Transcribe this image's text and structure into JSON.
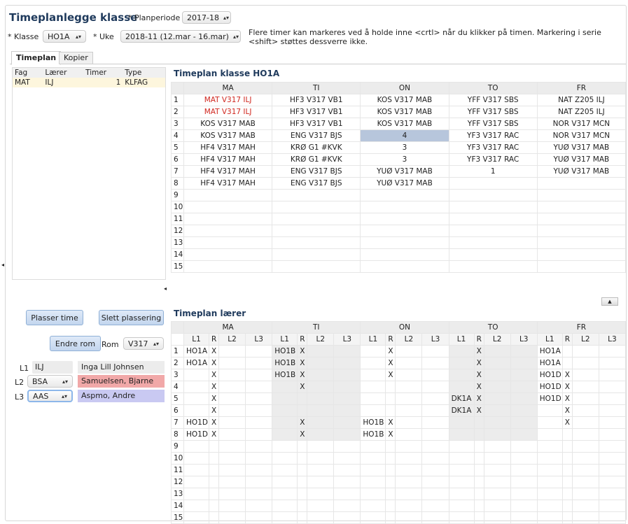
{
  "header": {
    "title": "Timeplanlegge klasse",
    "planperiode_label": "* Planperiode",
    "planperiode_value": "2017-18",
    "klasse_label": "* Klasse",
    "klasse_value": "HO1A",
    "uke_label": "* Uke",
    "uke_value": "2018-11 (12.mar - 16.mar)",
    "hint": "Flere timer kan markeres ved å holde inne <crtl> når du klikker på timen. Markering i serie <shift> støttes dessverre ikke."
  },
  "tabs": [
    {
      "label": "Timeplan"
    },
    {
      "label": "Kopier"
    }
  ],
  "subjects": {
    "headers": [
      "Fag",
      "Lærer",
      "Timer",
      "Type"
    ],
    "rows": [
      {
        "fag": "MAT",
        "laerer": "ILJ",
        "timer": "1",
        "type": "KLFAG"
      }
    ]
  },
  "class_schedule": {
    "title": "Timeplan klasse HO1A",
    "days": [
      "MA",
      "TI",
      "ON",
      "TO",
      "FR"
    ],
    "row_numbers": [
      "1",
      "2",
      "3",
      "4",
      "5",
      "6",
      "7",
      "8",
      "9",
      "10",
      "11",
      "12",
      "13",
      "14",
      "15"
    ],
    "rows": [
      [
        "MAT V317 ILJ",
        "HF3 V317 VB1",
        "KOS V317 MAB",
        "YFF V317 SBS",
        "NAT Z205 ILJ"
      ],
      [
        "MAT V317 ILJ",
        "HF3 V317 VB1",
        "KOS V317 MAB",
        "YFF V317 SBS",
        "NAT Z205 ILJ"
      ],
      [
        "KOS V317 MAB",
        "HF3 V317 VB1",
        "KOS V317 MAB",
        "YFF V317 SBS",
        "NOR V317 MCN"
      ],
      [
        "KOS V317 MAB",
        "ENG V317 BJS",
        "4",
        "YF3 V317 RAC",
        "NOR V317 MCN"
      ],
      [
        "HF4 V317 MAH",
        "KRØ G1 #KVK",
        "3",
        "YF3 V317 RAC",
        "YUØ V317 MAB"
      ],
      [
        "HF4 V317 MAH",
        "KRØ G1 #KVK",
        "3",
        "YF3 V317 RAC",
        "YUØ V317 MAB"
      ],
      [
        "HF4 V317 MAH",
        "ENG V317 BJS",
        "YUØ V317 MAB",
        "1",
        "YUØ V317 MAB"
      ],
      [
        "HF4 V317 MAH",
        "ENG V317 BJS",
        "YUØ V317 MAB",
        "",
        ""
      ],
      [
        "",
        "",
        "",
        "",
        ""
      ],
      [
        "",
        "",
        "",
        "",
        ""
      ],
      [
        "",
        "",
        "",
        "",
        ""
      ],
      [
        "",
        "",
        "",
        "",
        ""
      ],
      [
        "",
        "",
        "",
        "",
        ""
      ],
      [
        "",
        "",
        "",
        "",
        ""
      ],
      [
        "",
        "",
        "",
        "",
        ""
      ]
    ],
    "highlight_color": "#b7c6dc",
    "red_color": "#d0261e"
  },
  "buttons": {
    "plasser": "Plasser time",
    "slett": "Slett plassering",
    "endre_rom": "Endre rom"
  },
  "rom": {
    "label": "Rom",
    "value": "V317"
  },
  "teachers": [
    {
      "slot": "L1",
      "code": "ILJ",
      "name": "Inga Lill Johnsen",
      "color": "#ececec"
    },
    {
      "slot": "L2",
      "code": "BSA",
      "name": "Samuelsen, Bjarne",
      "color": "#f1a8a8"
    },
    {
      "slot": "L3",
      "code": "AAS",
      "name": "Aspmo, Andre",
      "color": "#c9c9f2"
    }
  ],
  "teacher_schedule": {
    "title": "Timeplan lærer",
    "days": [
      "MA",
      "TI",
      "ON",
      "TO",
      "FR"
    ],
    "subcols": [
      "L1",
      "R",
      "L2",
      "L3"
    ],
    "rows": [
      [
        [
          "HO1A",
          "X",
          "",
          ""
        ],
        [
          "HO1B",
          "X",
          "",
          ""
        ],
        [
          "",
          "X",
          "",
          ""
        ],
        [
          "",
          "X",
          "",
          ""
        ],
        [
          "HO1A",
          "",
          "",
          ""
        ]
      ],
      [
        [
          "HO1A",
          "X",
          "",
          ""
        ],
        [
          "HO1B",
          "X",
          "",
          ""
        ],
        [
          "",
          "X",
          "",
          ""
        ],
        [
          "",
          "X",
          "",
          ""
        ],
        [
          "HO1A",
          "",
          "",
          ""
        ]
      ],
      [
        [
          "",
          "X",
          "",
          ""
        ],
        [
          "HO1B",
          "X",
          "",
          ""
        ],
        [
          "",
          "X",
          "",
          ""
        ],
        [
          "",
          "X",
          "",
          ""
        ],
        [
          "HO1D",
          "X",
          "",
          ""
        ]
      ],
      [
        [
          "",
          "X",
          "",
          ""
        ],
        [
          "",
          "X",
          "",
          ""
        ],
        [
          "",
          "",
          "",
          ""
        ],
        [
          "",
          "X",
          "",
          ""
        ],
        [
          "HO1D",
          "X",
          "",
          ""
        ]
      ],
      [
        [
          "",
          "X",
          "",
          ""
        ],
        [
          "",
          "",
          "",
          ""
        ],
        [
          "",
          "",
          "",
          ""
        ],
        [
          "DK1A",
          "X",
          "",
          ""
        ],
        [
          "HO1D",
          "X",
          "",
          ""
        ]
      ],
      [
        [
          "",
          "X",
          "",
          ""
        ],
        [
          "",
          "",
          "",
          ""
        ],
        [
          "",
          "",
          "",
          ""
        ],
        [
          "DK1A",
          "X",
          "",
          ""
        ],
        [
          "",
          "X",
          "",
          ""
        ]
      ],
      [
        [
          "HO1D",
          "X",
          "",
          ""
        ],
        [
          "",
          "X",
          "",
          ""
        ],
        [
          "HO1B",
          "X",
          "",
          ""
        ],
        [
          "",
          "",
          "",
          ""
        ],
        [
          "",
          "X",
          "",
          ""
        ]
      ],
      [
        [
          "HO1D",
          "X",
          "",
          ""
        ],
        [
          "",
          "X",
          "",
          ""
        ],
        [
          "HO1B",
          "X",
          "",
          ""
        ],
        [
          "",
          "",
          "",
          ""
        ],
        [
          "",
          "",
          "",
          ""
        ]
      ],
      [
        [
          "",
          "",
          "",
          ""
        ],
        [
          "",
          "",
          "",
          ""
        ],
        [
          "",
          "",
          "",
          ""
        ],
        [
          "",
          "",
          "",
          ""
        ],
        [
          "",
          "",
          "",
          ""
        ]
      ],
      [
        [
          "",
          "",
          "",
          ""
        ],
        [
          "",
          "",
          "",
          ""
        ],
        [
          "",
          "",
          "",
          ""
        ],
        [
          "",
          "",
          "",
          ""
        ],
        [
          "",
          "",
          "",
          ""
        ]
      ],
      [
        [
          "",
          "",
          "",
          ""
        ],
        [
          "",
          "",
          "",
          ""
        ],
        [
          "",
          "",
          "",
          ""
        ],
        [
          "",
          "",
          "",
          ""
        ],
        [
          "",
          "",
          "",
          ""
        ]
      ],
      [
        [
          "",
          "",
          "",
          ""
        ],
        [
          "",
          "",
          "",
          ""
        ],
        [
          "",
          "",
          "",
          ""
        ],
        [
          "",
          "",
          "",
          ""
        ],
        [
          "",
          "",
          "",
          ""
        ]
      ],
      [
        [
          "",
          "",
          "",
          ""
        ],
        [
          "",
          "",
          "",
          ""
        ],
        [
          "",
          "",
          "",
          ""
        ],
        [
          "",
          "",
          "",
          ""
        ],
        [
          "",
          "",
          "",
          ""
        ]
      ],
      [
        [
          "",
          "",
          "",
          ""
        ],
        [
          "",
          "",
          "",
          ""
        ],
        [
          "",
          "",
          "",
          ""
        ],
        [
          "",
          "",
          "",
          ""
        ],
        [
          "",
          "",
          "",
          ""
        ]
      ],
      [
        [
          "",
          "",
          "",
          ""
        ],
        [
          "",
          "",
          "",
          ""
        ],
        [
          "",
          "",
          "",
          ""
        ],
        [
          "",
          "",
          "",
          ""
        ],
        [
          "",
          "",
          "",
          ""
        ]
      ]
    ]
  }
}
